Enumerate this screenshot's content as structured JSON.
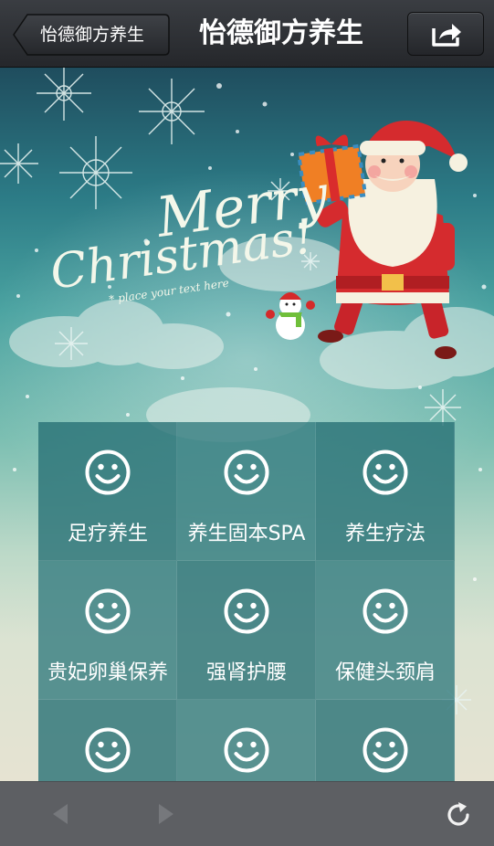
{
  "navbar": {
    "back_label": "怡德御方养生",
    "title": "怡德御方养生",
    "share_icon": "share-icon"
  },
  "banner": {
    "headline_line1": "Merry",
    "headline_line2": "Christmas!",
    "tagline": "* place your text here"
  },
  "grid": {
    "items": [
      {
        "label": "足疗养生",
        "icon": "smiley-icon"
      },
      {
        "label": "养生固本SPA",
        "icon": "smiley-icon"
      },
      {
        "label": "养生疗法",
        "icon": "smiley-icon"
      },
      {
        "label": "贵妃卵巢保养",
        "icon": "smiley-icon"
      },
      {
        "label": "强肾护腰",
        "icon": "smiley-icon"
      },
      {
        "label": "保健头颈肩",
        "icon": "smiley-icon"
      },
      {
        "label": "",
        "icon": "smiley-icon"
      },
      {
        "label": "",
        "icon": "smiley-icon"
      },
      {
        "label": "",
        "icon": "smiley-icon"
      }
    ]
  },
  "toolbar": {
    "back_icon": "triangle-left-icon",
    "forward_icon": "triangle-right-icon",
    "refresh_icon": "refresh-icon"
  },
  "colors": {
    "navbar": "#2e3034",
    "tile": "#2f7479",
    "toolbar": "#5d5f63"
  }
}
